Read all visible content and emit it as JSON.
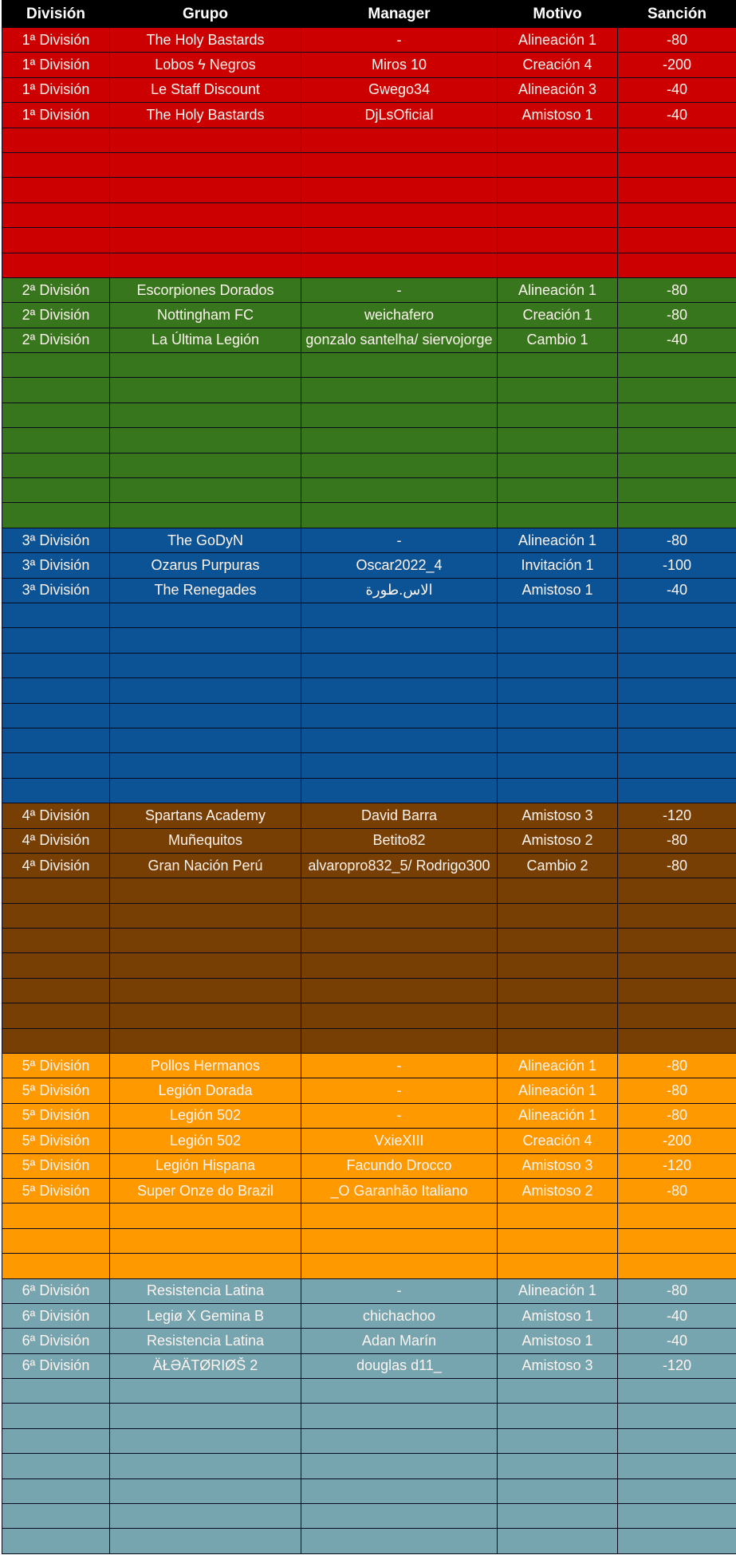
{
  "columns": [
    "División",
    "Grupo",
    "Manager",
    "Motivo",
    "Sanción"
  ],
  "colors": {
    "header_bg": "#000000",
    "div-1": "#cc0000",
    "div-2": "#38761d",
    "div-3": "#0b5394",
    "div-4": "#783f04",
    "div-5": "#ff9900",
    "div-6": "#76a5af"
  },
  "sections": [
    {
      "key": "div-1",
      "empty_rows": 6,
      "rows": [
        [
          "1ª División",
          "The Holy Bastards",
          "-",
          "Alineación 1",
          "-80"
        ],
        [
          "1ª División",
          "Lobos ϟ Negros",
          "Miros 10",
          "Creación 4",
          "-200"
        ],
        [
          "1ª División",
          "Le Staff Discount",
          "Gwego34",
          "Alineación 3",
          "-40"
        ],
        [
          "1ª División",
          "The Holy Bastards",
          "DjLsOficial",
          "Amistoso 1",
          "-40"
        ]
      ]
    },
    {
      "key": "div-2",
      "empty_rows": 7,
      "rows": [
        [
          "2ª División",
          "Escorpiones Dorados",
          "-",
          "Alineación 1",
          "-80"
        ],
        [
          "2ª División",
          "Nottingham FC",
          "weichafero",
          "Creación 1",
          "-80"
        ],
        [
          "2ª División",
          "La Última Legión",
          "gonzalo santelha/ siervojorge",
          "Cambio 1",
          "-40"
        ]
      ]
    },
    {
      "key": "div-3",
      "empty_rows": 8,
      "rows": [
        [
          "3ª División",
          "The GoDyN",
          "-",
          "Alineación 1",
          "-80"
        ],
        [
          "3ª División",
          "Ozarus Purpuras",
          "Oscar2022_4",
          "Invitación 1",
          "-100"
        ],
        [
          "3ª División",
          "The Renegades",
          "الاس.طورة",
          "Amistoso 1",
          "-40"
        ]
      ]
    },
    {
      "key": "div-4",
      "empty_rows": 7,
      "rows": [
        [
          "4ª División",
          "Spartans Academy",
          "David Barra",
          "Amistoso 3",
          "-120"
        ],
        [
          "4ª División",
          "Muñequitos",
          "Betito82",
          "Amistoso 2",
          "-80"
        ],
        [
          "4ª División",
          "Gran Nación Perú",
          "alvaropro832_5/ Rodrigo300",
          "Cambio 2",
          "-80"
        ]
      ]
    },
    {
      "key": "div-5",
      "empty_rows": 3,
      "rows": [
        [
          "5ª División",
          "Pollos Hermanos",
          "-",
          "Alineación 1",
          "-80"
        ],
        [
          "5ª División",
          "Legión Dorada",
          "-",
          "Alineación 1",
          "-80"
        ],
        [
          "5ª División",
          "Legión 502",
          "-",
          "Alineación 1",
          "-80"
        ],
        [
          "5ª División",
          "Legión 502",
          "VxieXIII",
          "Creación 4",
          "-200"
        ],
        [
          "5ª División",
          "Legión Hispana",
          "Facundo Drocco",
          "Amistoso 3",
          "-120"
        ],
        [
          "5ª División",
          "Super Onze do Brazil",
          "_O Garanhão Italiano",
          "Amistoso 2",
          "-80"
        ]
      ]
    },
    {
      "key": "div-6",
      "empty_rows": 7,
      "rows": [
        [
          "6ª División",
          "Resistencia Latina",
          "-",
          "Alineación 1",
          "-80"
        ],
        [
          "6ª División",
          "Legiø X Gemina B",
          "chichachoo",
          "Amistoso 1",
          "-40"
        ],
        [
          "6ª División",
          "Resistencia Latina",
          "Adan Marín",
          "Amistoso 1",
          "-40"
        ],
        [
          "6ª División",
          "ÄŁƏÄTØRIØŠ 2",
          "douglas d11_",
          "Amistoso 3",
          "-120"
        ]
      ]
    }
  ]
}
